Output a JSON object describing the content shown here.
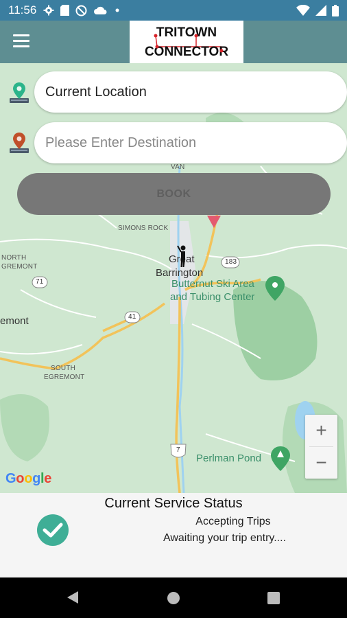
{
  "status_bar": {
    "time": "11:56",
    "left_icons": [
      "gear-icon",
      "sd-card-icon",
      "no-sync-icon",
      "cloud-icon",
      "dot-icon"
    ],
    "right_icons": [
      "wifi-icon",
      "cell-signal-icon",
      "battery-icon"
    ]
  },
  "app_bar": {
    "logo_line1": "TRITOWN",
    "logo_line2": "CONNECTOR"
  },
  "search": {
    "current_value": "Current Location",
    "destination_placeholder": "Please Enter Destination"
  },
  "book_button": {
    "label": "BOOK"
  },
  "map": {
    "labels": {
      "van": "VAN",
      "simons_rock": "SIMONS ROCK",
      "north_egremont_1": "NORTH",
      "north_egremont_2": "GREMONT",
      "south_egremont_1": "SOUTH",
      "south_egremont_2": "EGREMONT",
      "great_1": "Great",
      "great_2": "Barrington",
      "egremont": "emont",
      "butternut_1": "Butternut Ski Area",
      "butternut_2": "and Tubing Center",
      "perlman": "Perlman Pond",
      "route_183": "183",
      "route_71": "71",
      "route_41": "41",
      "route_7": "7"
    },
    "zoom_in": "+",
    "zoom_out": "−",
    "google": "Google"
  },
  "service_status": {
    "title": "Current Service Status",
    "line1": "Accepting Trips",
    "line2": "Awaiting your trip entry...."
  },
  "colors": {
    "status_bar": "#3b7ea0",
    "app_bar": "#5e8e92",
    "check": "#3fae96",
    "logo_red": "#d8232a"
  }
}
